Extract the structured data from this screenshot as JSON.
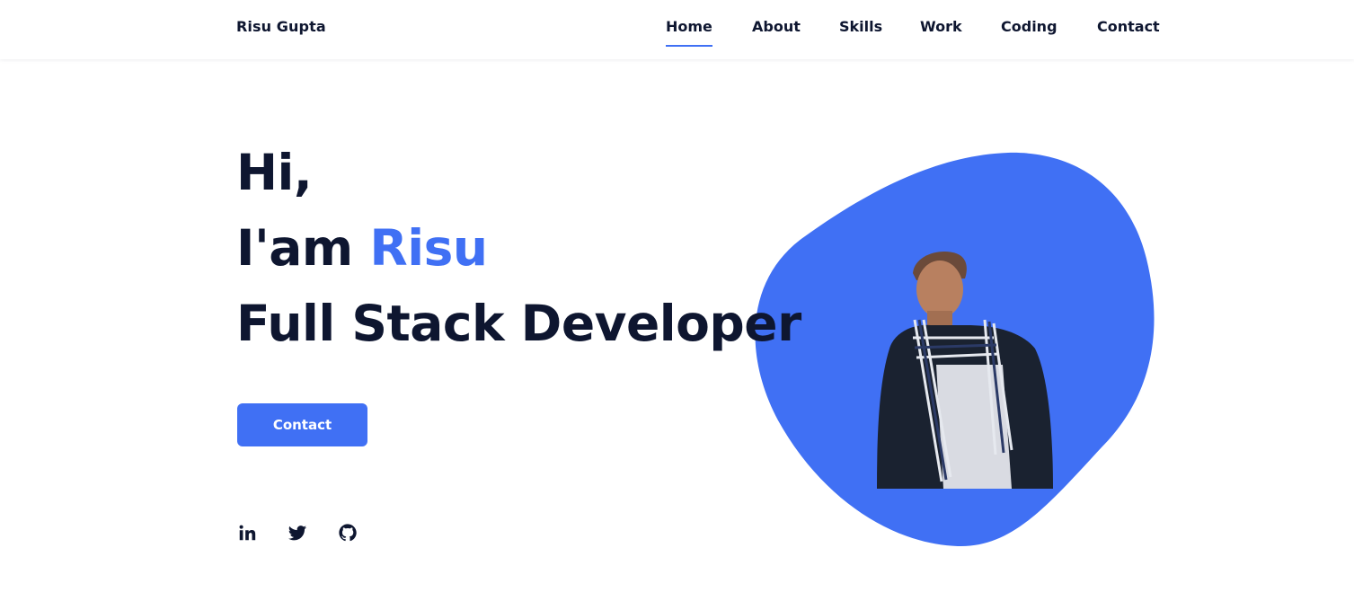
{
  "header": {
    "logo": "Risu Gupta",
    "nav": [
      {
        "label": "Home",
        "active": true
      },
      {
        "label": "About",
        "active": false
      },
      {
        "label": "Skills",
        "active": false
      },
      {
        "label": "Work",
        "active": false
      },
      {
        "label": "Coding",
        "active": false
      },
      {
        "label": "Contact",
        "active": false
      }
    ]
  },
  "hero": {
    "greeting": "Hi,",
    "intro_prefix": "I'am",
    "name": "Risu",
    "role": "Full Stack Developer",
    "cta_label": "Contact"
  },
  "social": [
    {
      "icon": "linkedin-icon"
    },
    {
      "icon": "twitter-icon"
    },
    {
      "icon": "github-icon"
    }
  ],
  "colors": {
    "accent": "#4070f4",
    "text": "#0e1630",
    "background": "#ffffff"
  }
}
